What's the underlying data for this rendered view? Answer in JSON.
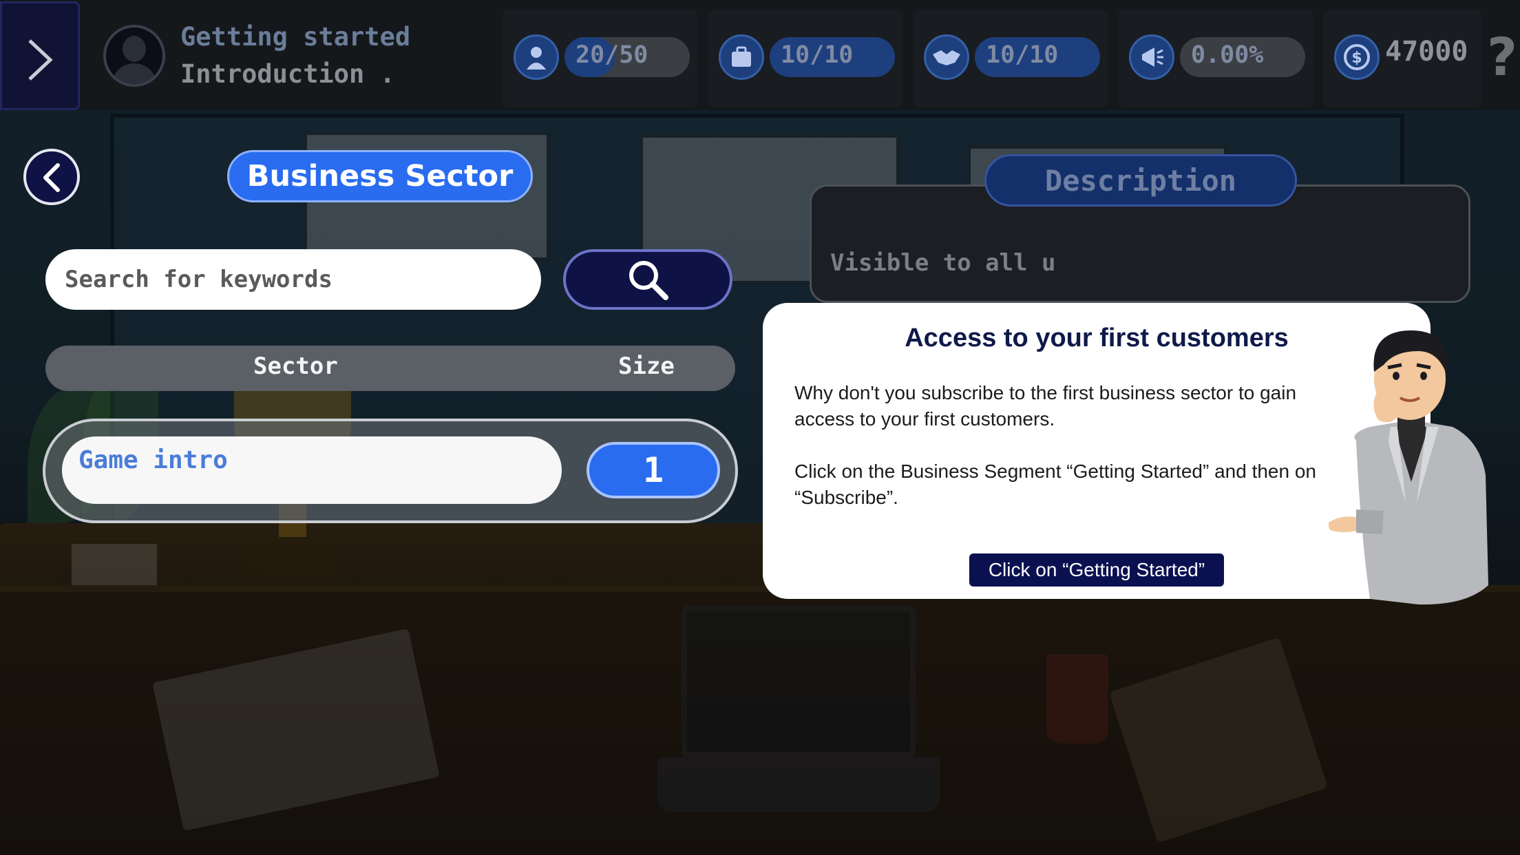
{
  "header": {
    "chapter_title": "Getting started",
    "chapter_subtitle": "Introduction .",
    "stats": [
      {
        "icon": "employee-icon",
        "value": "20/50",
        "fill": 0.4
      },
      {
        "icon": "briefcase-icon",
        "value": "10/10",
        "fill": 1.0
      },
      {
        "icon": "handshake-icon",
        "value": "10/10",
        "fill": 1.0
      },
      {
        "icon": "megaphone-icon",
        "value": "0.00%",
        "fill": 0.0
      }
    ],
    "coins": {
      "icon": "coin-icon",
      "value": "47000"
    },
    "help_label": "?"
  },
  "business_sector": {
    "title": "Business Sector",
    "search_placeholder": "Search for keywords",
    "columns": {
      "sector": "Sector",
      "size": "Size"
    },
    "rows": [
      {
        "sector": "Game intro",
        "size": "1"
      }
    ]
  },
  "description": {
    "title": "Description",
    "text": "Visible to all u"
  },
  "tutorial": {
    "title": "Access to your first customers",
    "paragraph1": "Why don't you subscribe to the first business sector to gain access to your first customers.",
    "paragraph2": "Click on the Business Segment “Getting Started” and then on “Subscribe”.",
    "button_label": "Click on “Getting Started”"
  },
  "colors": {
    "accent_blue": "#2a6cf0",
    "navy": "#0f1245",
    "panel_dark": "#1b1e22"
  }
}
